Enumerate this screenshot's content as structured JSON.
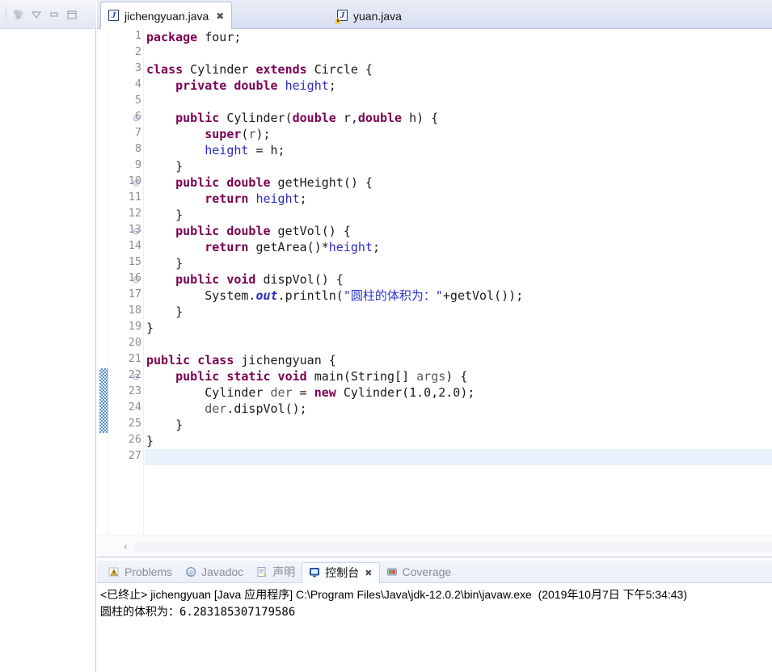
{
  "left_panel": {
    "toolbar_icons": [
      "package-presentation-icon",
      "view-menu-icon",
      "minimize-icon",
      "maximize-icon"
    ]
  },
  "editor": {
    "tabs": [
      {
        "label": "jichengyuan.java",
        "icon": "java-file-icon",
        "active": true,
        "closable": true,
        "close_glyph": "✖"
      },
      {
        "label": "yuan.java",
        "icon": "java-file-warning-icon",
        "active": false,
        "closable": false
      }
    ],
    "scroll_left_glyph": "‹",
    "current_line": 27,
    "changed_lines": [
      22,
      23,
      24,
      25
    ],
    "fold_lines": [
      6,
      10,
      13,
      16,
      22
    ],
    "fold_glyph": "⊝",
    "lines": [
      {
        "n": 1,
        "tokens": [
          {
            "t": "package",
            "c": "kw"
          },
          {
            "t": " four;",
            "c": ""
          }
        ]
      },
      {
        "n": 2,
        "tokens": []
      },
      {
        "n": 3,
        "tokens": [
          {
            "t": "class",
            "c": "kw"
          },
          {
            "t": " Cylinder ",
            "c": ""
          },
          {
            "t": "extends",
            "c": "kw"
          },
          {
            "t": " Circle {",
            "c": ""
          }
        ]
      },
      {
        "n": 4,
        "tokens": [
          {
            "t": "    ",
            "c": ""
          },
          {
            "t": "private double",
            "c": "kw"
          },
          {
            "t": " ",
            "c": ""
          },
          {
            "t": "height",
            "c": "fld"
          },
          {
            "t": ";",
            "c": ""
          }
        ]
      },
      {
        "n": 5,
        "tokens": []
      },
      {
        "n": 6,
        "tokens": [
          {
            "t": "    ",
            "c": ""
          },
          {
            "t": "public",
            "c": "kw"
          },
          {
            "t": " Cylinder(",
            "c": ""
          },
          {
            "t": "double",
            "c": "kw"
          },
          {
            "t": " r,",
            "c": ""
          },
          {
            "t": "double",
            "c": "kw"
          },
          {
            "t": " h) {",
            "c": ""
          }
        ]
      },
      {
        "n": 7,
        "tokens": [
          {
            "t": "        ",
            "c": ""
          },
          {
            "t": "super",
            "c": "kw"
          },
          {
            "t": "(",
            "c": ""
          },
          {
            "t": "r",
            "c": "par"
          },
          {
            "t": ");",
            "c": ""
          }
        ]
      },
      {
        "n": 8,
        "tokens": [
          {
            "t": "        ",
            "c": ""
          },
          {
            "t": "height",
            "c": "fld"
          },
          {
            "t": " = h;",
            "c": ""
          }
        ]
      },
      {
        "n": 9,
        "tokens": [
          {
            "t": "    }",
            "c": ""
          }
        ]
      },
      {
        "n": 10,
        "tokens": [
          {
            "t": "    ",
            "c": ""
          },
          {
            "t": "public double",
            "c": "kw"
          },
          {
            "t": " getHeight() {",
            "c": ""
          }
        ]
      },
      {
        "n": 11,
        "tokens": [
          {
            "t": "        ",
            "c": ""
          },
          {
            "t": "return",
            "c": "kw"
          },
          {
            "t": " ",
            "c": ""
          },
          {
            "t": "height",
            "c": "fld"
          },
          {
            "t": ";",
            "c": ""
          }
        ]
      },
      {
        "n": 12,
        "tokens": [
          {
            "t": "    }",
            "c": ""
          }
        ]
      },
      {
        "n": 13,
        "tokens": [
          {
            "t": "    ",
            "c": ""
          },
          {
            "t": "public double",
            "c": "kw"
          },
          {
            "t": " getVol() {",
            "c": ""
          }
        ]
      },
      {
        "n": 14,
        "tokens": [
          {
            "t": "        ",
            "c": ""
          },
          {
            "t": "return",
            "c": "kw"
          },
          {
            "t": " getArea()*",
            "c": ""
          },
          {
            "t": "height",
            "c": "fld"
          },
          {
            "t": ";",
            "c": ""
          }
        ]
      },
      {
        "n": 15,
        "tokens": [
          {
            "t": "    }",
            "c": ""
          }
        ]
      },
      {
        "n": 16,
        "tokens": [
          {
            "t": "    ",
            "c": ""
          },
          {
            "t": "public void",
            "c": "kw"
          },
          {
            "t": " dispVol() {",
            "c": ""
          }
        ]
      },
      {
        "n": 17,
        "tokens": [
          {
            "t": "        System.",
            "c": ""
          },
          {
            "t": "out",
            "c": "fldi"
          },
          {
            "t": ".println(",
            "c": ""
          },
          {
            "t": "\"圆柱的体积为：\"",
            "c": "str"
          },
          {
            "t": "+getVol());",
            "c": ""
          }
        ]
      },
      {
        "n": 18,
        "tokens": [
          {
            "t": "    }",
            "c": ""
          }
        ]
      },
      {
        "n": 19,
        "tokens": [
          {
            "t": "}",
            "c": ""
          }
        ]
      },
      {
        "n": 20,
        "tokens": []
      },
      {
        "n": 21,
        "tokens": [
          {
            "t": "public class",
            "c": "kw"
          },
          {
            "t": " jichengyuan {",
            "c": ""
          }
        ]
      },
      {
        "n": 22,
        "tokens": [
          {
            "t": "    ",
            "c": ""
          },
          {
            "t": "public static void",
            "c": "kw"
          },
          {
            "t": " main(String[] ",
            "c": ""
          },
          {
            "t": "args",
            "c": "par"
          },
          {
            "t": ") {",
            "c": ""
          }
        ]
      },
      {
        "n": 23,
        "tokens": [
          {
            "t": "        Cylinder ",
            "c": ""
          },
          {
            "t": "der",
            "c": "par"
          },
          {
            "t": " = ",
            "c": ""
          },
          {
            "t": "new",
            "c": "kw"
          },
          {
            "t": " Cylinder(1.0,2.0);",
            "c": ""
          }
        ]
      },
      {
        "n": 24,
        "tokens": [
          {
            "t": "        ",
            "c": ""
          },
          {
            "t": "der",
            "c": "par"
          },
          {
            "t": ".dispVol();",
            "c": ""
          }
        ]
      },
      {
        "n": 25,
        "tokens": [
          {
            "t": "    }",
            "c": ""
          }
        ]
      },
      {
        "n": 26,
        "tokens": [
          {
            "t": "}",
            "c": ""
          }
        ]
      },
      {
        "n": 27,
        "tokens": []
      }
    ]
  },
  "console": {
    "tabs": [
      {
        "label": "Problems",
        "icon": "problems-icon",
        "active": false
      },
      {
        "label": "Javadoc",
        "icon": "javadoc-icon",
        "active": false
      },
      {
        "label": "声明",
        "icon": "declaration-icon",
        "active": false
      },
      {
        "label": "控制台",
        "icon": "console-icon",
        "active": true,
        "close_glyph": "✖"
      },
      {
        "label": "Coverage",
        "icon": "coverage-icon",
        "active": false
      }
    ],
    "header": "<已终止> jichengyuan [Java 应用程序] C:\\Program Files\\Java\\jdk-12.0.2\\bin\\javaw.exe  (2019年10月7日 下午5:34:43)",
    "output": "圆柱的体积为：6.283185307179586"
  },
  "colors": {
    "keyword": "#7b0052",
    "field": "#2b2bc4",
    "string": "#2a33c8",
    "parameter": "#5a5a5a",
    "current_line_highlight": "#e9f1fd",
    "changed_marker": "#5b8fc9",
    "tab_active_bg": "#ffffff",
    "tabbar_bg": "#dfe5f3"
  }
}
